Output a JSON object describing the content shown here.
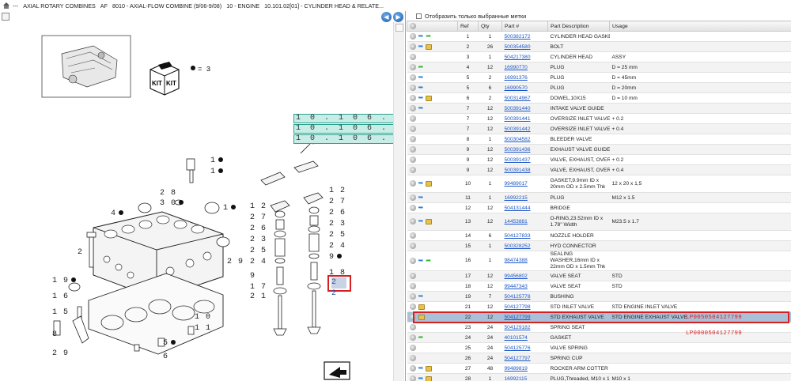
{
  "breadcrumb": [
    "---",
    "AXIAL ROTARY COMBINES",
    "AF",
    "8010 - AXIAL-FLOW COMBINE (9/06-9/08)",
    "10 - ENGINE",
    "10.101.02[01] - CYLINDER HEAD & RELATE..."
  ],
  "nav": {
    "back_glyph": "◀",
    "forward_glyph": "▶"
  },
  "diagram": {
    "kit_text": "KIT",
    "kit_label": "= 3",
    "ref_boxes": [
      "1 0 . 1 0 6 .",
      "1 0 . 1 0 6 .",
      "1 0 . 1 0 6 ."
    ],
    "highlight_label": "2 2",
    "callouts": [
      {
        "text": "1",
        "dot": true
      },
      {
        "text": "1",
        "dot": true
      },
      {
        "text": "2 8",
        "dot": false
      },
      {
        "text": "3 0",
        "dot": true
      },
      {
        "text": "1",
        "dot": true
      },
      {
        "text": "4",
        "dot": true
      },
      {
        "text": "2",
        "dot": false
      },
      {
        "text": "2 9",
        "dot": false
      },
      {
        "text": "1 9",
        "dot": true
      },
      {
        "text": "1 6",
        "dot": false
      },
      {
        "text": "1 5",
        "dot": false
      },
      {
        "text": "8",
        "dot": false
      },
      {
        "text": "2 9",
        "dot": false
      },
      {
        "text": "1 0",
        "dot": false
      },
      {
        "text": "1 1",
        "dot": false
      },
      {
        "text": "5",
        "dot": true
      },
      {
        "text": "6",
        "dot": false
      },
      {
        "text": "1 2",
        "dot": false
      },
      {
        "text": "2 7",
        "dot": false
      },
      {
        "text": "2 6",
        "dot": false
      },
      {
        "text": "2 3",
        "dot": false
      },
      {
        "text": "2 5",
        "dot": false
      },
      {
        "text": "2 4",
        "dot": false
      },
      {
        "text": "9",
        "dot": false
      },
      {
        "text": "1 7",
        "dot": false
      },
      {
        "text": "2 1",
        "dot": false
      },
      {
        "text": "1 2",
        "dot": false
      },
      {
        "text": "2 7",
        "dot": false
      },
      {
        "text": "2 6",
        "dot": false
      },
      {
        "text": "2 3",
        "dot": false
      },
      {
        "text": "2 5",
        "dot": false
      },
      {
        "text": "2 4",
        "dot": false
      },
      {
        "text": "9",
        "dot": true
      },
      {
        "text": "1 8",
        "dot": false
      }
    ]
  },
  "filter_label": "Отобразить только выбранные метки",
  "columns": [
    "",
    "Ref",
    "Qty",
    "Part #",
    "Part Description",
    "Usage"
  ],
  "rows": [
    {
      "icons": [
        "g",
        "b",
        "gr"
      ],
      "ref": "1",
      "qty": "1",
      "part": "500382172",
      "desc": "CYLINDER HEAD GASKET",
      "usage": ""
    },
    {
      "icons": [
        "g",
        "b",
        "k"
      ],
      "ref": "2",
      "qty": "26",
      "part": "500354580",
      "desc": "BOLT",
      "usage": ""
    },
    {
      "icons": [
        "g"
      ],
      "ref": "3",
      "qty": "1",
      "part": "504217380",
      "desc": "CYLINDER HEAD",
      "usage": "ASSY"
    },
    {
      "icons": [
        "g",
        "gr"
      ],
      "ref": "4",
      "qty": "12",
      "part": "16990770",
      "desc": "PLUG",
      "usage": "D = 25 mm"
    },
    {
      "icons": [
        "g",
        "b"
      ],
      "ref": "5",
      "qty": "2",
      "part": "16991376",
      "desc": "PLUG",
      "usage": "D = 45mm"
    },
    {
      "icons": [
        "g",
        "b"
      ],
      "ref": "5",
      "qty": "6",
      "part": "16990570",
      "desc": "PLUG",
      "usage": "D = 20mm"
    },
    {
      "icons": [
        "g",
        "b",
        "k"
      ],
      "ref": "6",
      "qty": "2",
      "part": "500314967",
      "desc": "DOWEL,10X15",
      "usage": "D = 10 mm"
    },
    {
      "icons": [
        "g",
        "b"
      ],
      "ref": "7",
      "qty": "12",
      "part": "500391440",
      "desc": "INTAKE VALVE GUIDE",
      "usage": ""
    },
    {
      "icons": [
        "g"
      ],
      "ref": "7",
      "qty": "12",
      "part": "500391441",
      "desc": "OVERSIZE INLET VALVE",
      "usage": "+ 0.2"
    },
    {
      "icons": [
        "g"
      ],
      "ref": "7",
      "qty": "12",
      "part": "500391442",
      "desc": "OVERSIZE INLET VALVE",
      "usage": "+ 0.4"
    },
    {
      "icons": [
        "g"
      ],
      "ref": "8",
      "qty": "1",
      "part": "500304582",
      "desc": "BLEEDER VALVE",
      "usage": ""
    },
    {
      "icons": [
        "g"
      ],
      "ref": "9",
      "qty": "12",
      "part": "500391436",
      "desc": "EXHAUST VALVE GUIDE",
      "usage": ""
    },
    {
      "icons": [
        "g"
      ],
      "ref": "9",
      "qty": "12",
      "part": "500391437",
      "desc": "VALVE, EXHAUST, OVER",
      "usage": "+ 0.2"
    },
    {
      "icons": [
        "g"
      ],
      "ref": "9",
      "qty": "12",
      "part": "500391438",
      "desc": "VALVE, EXHAUST, OVER",
      "usage": "+ 0.4"
    },
    {
      "icons": [
        "g",
        "b",
        "k"
      ],
      "ref": "10",
      "qty": "1",
      "part": "99489017",
      "desc": "GASKET,9.9mm ID x 20mm OD x 2.5mm Thk",
      "usage": "12 x 20 x 1,5",
      "tall": true
    },
    {
      "icons": [
        "g",
        "b"
      ],
      "ref": "11",
      "qty": "1",
      "part": "16992215",
      "desc": "PLUG",
      "usage": "M12 x 1.5"
    },
    {
      "icons": [
        "g",
        "b"
      ],
      "ref": "12",
      "qty": "12",
      "part": "504131444",
      "desc": "BRIDGE",
      "usage": ""
    },
    {
      "icons": [
        "g",
        "b",
        "k"
      ],
      "ref": "13",
      "qty": "12",
      "part": "14453881",
      "desc": "O-RING,23.52mm ID x 1.78\" Width",
      "usage": "M23.5 x 1.7",
      "tall": true
    },
    {
      "icons": [
        "g"
      ],
      "ref": "14",
      "qty": "6",
      "part": "504127833",
      "desc": "NOZZLE HOLDER",
      "usage": ""
    },
    {
      "icons": [
        "g"
      ],
      "ref": "15",
      "qty": "1",
      "part": "500328252",
      "desc": "HYD CONNECTOR",
      "usage": ""
    },
    {
      "icons": [
        "g",
        "b",
        "gr"
      ],
      "ref": "16",
      "qty": "1",
      "part": "98474388",
      "desc": "SEALING WASHER,16mm ID x 22mm OD x 1.5mm Thk",
      "usage": "",
      "tall": true
    },
    {
      "icons": [
        "g"
      ],
      "ref": "17",
      "qty": "12",
      "part": "99456802",
      "desc": "VALVE SEAT",
      "usage": "STD"
    },
    {
      "icons": [
        "g"
      ],
      "ref": "18",
      "qty": "12",
      "part": "99447343",
      "desc": "VALVE SEAT",
      "usage": "STD"
    },
    {
      "icons": [
        "g",
        "b"
      ],
      "ref": "19",
      "qty": "7",
      "part": "504125778",
      "desc": "BUSHING",
      "usage": ""
    },
    {
      "icons": [
        "g",
        "k"
      ],
      "ref": "21",
      "qty": "12",
      "part": "504127798",
      "desc": "STD INLET VALVE",
      "usage": "STD ENGINE INLET VALVE"
    },
    {
      "icons": [
        "g",
        "k"
      ],
      "ref": "22",
      "qty": "12",
      "part": "504127799",
      "desc": "STD EXHAUST VALVE",
      "usage": "STD ENGINE EXHAUST VALVE",
      "selected": true
    },
    {
      "icons": [
        "g"
      ],
      "ref": "23",
      "qty": "24",
      "part": "504129182",
      "desc": "SPRING SEAT",
      "usage": ""
    },
    {
      "icons": [
        "g",
        "gr"
      ],
      "ref": "24",
      "qty": "24",
      "part": "40101574",
      "desc": "GASKET",
      "usage": ""
    },
    {
      "icons": [
        "g"
      ],
      "ref": "25",
      "qty": "24",
      "part": "504125776",
      "desc": "VALVE SPRING",
      "usage": ""
    },
    {
      "icons": [
        "g"
      ],
      "ref": "26",
      "qty": "24",
      "part": "504127797",
      "desc": "SPRING CUP",
      "usage": ""
    },
    {
      "icons": [
        "g",
        "b",
        "k"
      ],
      "ref": "27",
      "qty": "48",
      "part": "99489819",
      "desc": "ROCKER ARM COTTER",
      "usage": ""
    },
    {
      "icons": [
        "g",
        "b",
        "k"
      ],
      "ref": "28",
      "qty": "1",
      "part": "16992115",
      "desc": "PLUG,Threaded, M10 x 1",
      "usage": "M10 x 1"
    }
  ],
  "annotations": {
    "lp1": "LP0050504127799",
    "lp2": "LP0000504127799"
  },
  "colors": {
    "highlight_red": "#d42020",
    "selected_row": "#aac0d8",
    "link_blue": "#1a55c8"
  }
}
